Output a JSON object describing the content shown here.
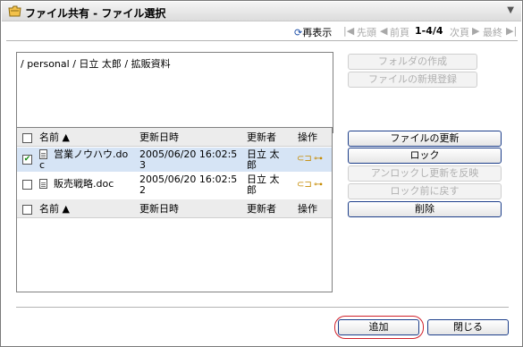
{
  "window": {
    "title": "ファイル共有 - ファイル選択",
    "menu_glyph": "▼"
  },
  "pager": {
    "refresh": "再表示",
    "first": "先頭",
    "prev": "前頁",
    "count": "1-4/4",
    "next": "次頁",
    "last": "最終"
  },
  "path": "/ personal / 日立 太郎 / 拡販資料",
  "folder_buttons": {
    "create_folder": "フォルダの作成",
    "new_file": "ファイルの新規登録"
  },
  "table": {
    "headers": {
      "name": "名前 ▲",
      "updated": "更新日時",
      "updater": "更新者",
      "ops": "操作"
    },
    "rows": [
      {
        "name_line1": "営業ノウハウ.do",
        "name_line2": "c",
        "updated_line1": "2005/06/20 16:02:5",
        "updated_line2": "3",
        "updater_line1": "日立 太",
        "updater_line2": "郎",
        "checked": "✔"
      },
      {
        "name_line1": "販売戦略.doc",
        "name_line2": "",
        "updated_line1": "2005/06/20 16:02:5",
        "updated_line2": "2",
        "updater_line1": "日立 太",
        "updater_line2": "郎",
        "checked": ""
      }
    ]
  },
  "side_buttons": {
    "update": "ファイルの更新",
    "lock": "ロック",
    "unlock_apply": "アンロックし更新を反映",
    "revert": "ロック前に戻す",
    "delete": "削除"
  },
  "footer_buttons": {
    "add": "追加",
    "close": "閉じる"
  },
  "icons": {
    "title": "folder-share-icon",
    "refresh": "refresh-icon",
    "first": "first-page-icon",
    "prev": "prev-page-icon",
    "next": "next-page-icon",
    "last": "last-page-icon",
    "doc": "document-icon",
    "tag": "tag-icon",
    "key": "key-icon"
  },
  "colors": {
    "selected_row": "#d6e4f5",
    "disabled_text": "#a8a8a8",
    "highlight_circle": "#d0202a",
    "check": "#138a13"
  }
}
